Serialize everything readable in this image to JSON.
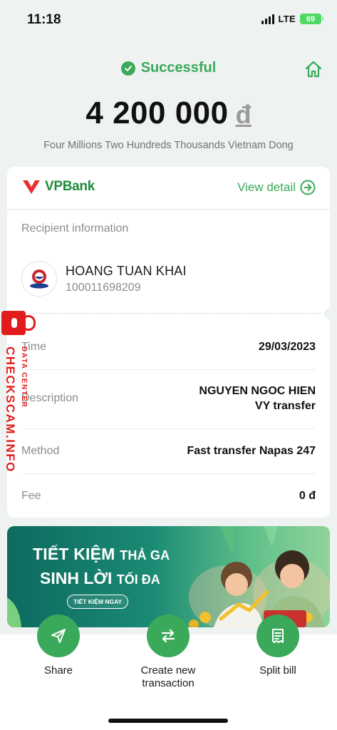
{
  "status_bar": {
    "time": "11:18",
    "network": "LTE",
    "battery": "69"
  },
  "header": {
    "status": "Successful",
    "amount": "4 200 000",
    "currency": "đ",
    "amount_words": "Four Millions Two Hundreds Thousands Vietnam Dong"
  },
  "card": {
    "bank_name": "VPBank",
    "view_detail": "View detail",
    "section_label": "Recipient information",
    "recipient_name": "HOANG TUAN KHAI",
    "recipient_account": "100011698209",
    "rows": [
      {
        "label": "Time",
        "value": "29/03/2023"
      },
      {
        "label": "Description",
        "value_line1": "NGUYEN NGOC HIEN",
        "value_line2": "VY transfer"
      },
      {
        "label": "Method",
        "value": "Fast transfer Napas 247"
      },
      {
        "label": "Fee",
        "value": "0 đ"
      }
    ]
  },
  "watermark": {
    "main": "CHECKSCAM.INFO",
    "sub": "DATA CENTER"
  },
  "banner": {
    "line1_big": "TIẾT KIỆM",
    "line1_small": "THẢ GA",
    "line2_big": "SINH LỜI",
    "line2_small": "TỐI ĐA",
    "button": "TIẾT KIỆM NGAY"
  },
  "actions": {
    "share": "Share",
    "create_line1": "Create new",
    "create_line2": "transaction",
    "split": "Split bill"
  },
  "colors": {
    "accent": "#3aaa5a",
    "watermark": "#e21c1c"
  }
}
